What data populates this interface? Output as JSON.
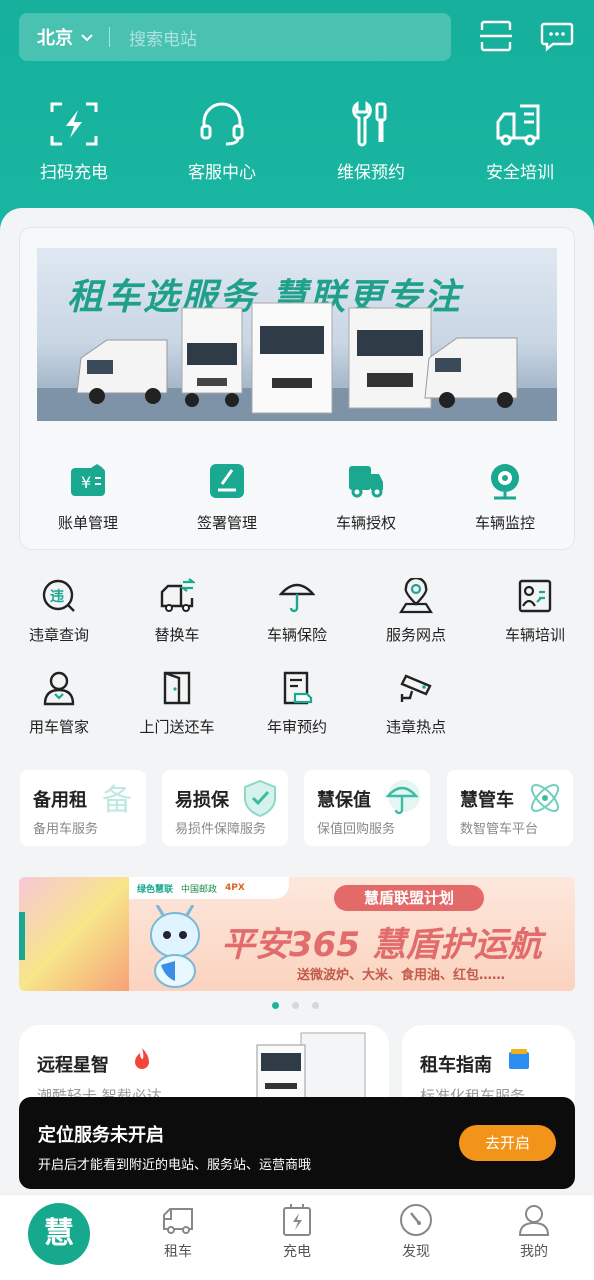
{
  "header": {
    "city": "北京",
    "search_placeholder": "搜索电站"
  },
  "quick_actions": [
    {
      "label": "扫码充电",
      "icon": "scan-charge-icon"
    },
    {
      "label": "客服中心",
      "icon": "headset-icon"
    },
    {
      "label": "维保预约",
      "icon": "tools-icon"
    },
    {
      "label": "安全培训",
      "icon": "truck-training-icon"
    }
  ],
  "banner": {
    "title": "租车选服务  慧联更专注"
  },
  "services": [
    {
      "label": "账单管理",
      "icon": "wallet-icon"
    },
    {
      "label": "签署管理",
      "icon": "sign-icon"
    },
    {
      "label": "车辆授权",
      "icon": "truck-auth-icon"
    },
    {
      "label": "车辆监控",
      "icon": "camera-icon"
    }
  ],
  "grid": [
    {
      "label": "违章查询",
      "icon": "violation-search-icon"
    },
    {
      "label": "替换车",
      "icon": "replace-car-icon"
    },
    {
      "label": "车辆保险",
      "icon": "umbrella-icon"
    },
    {
      "label": "服务网点",
      "icon": "location-icon"
    },
    {
      "label": "车辆培训",
      "icon": "training-icon"
    },
    {
      "label": "用车管家",
      "icon": "person-icon"
    },
    {
      "label": "上门送还车",
      "icon": "door-icon"
    },
    {
      "label": "年审预约",
      "icon": "inspection-icon"
    },
    {
      "label": "违章热点",
      "icon": "cctv-icon"
    }
  ],
  "mini_cards": [
    {
      "title": "备用租",
      "sub": "备用车服务"
    },
    {
      "title": "易损保",
      "sub": "易损件保障服务"
    },
    {
      "title": "慧保值",
      "sub": "保值回购服务"
    },
    {
      "title": "慧管车",
      "sub": "数智管车平台"
    }
  ],
  "promo": {
    "brand1": "绿色慧联",
    "brand2": "中国邮政",
    "brand3": "4PX",
    "plan": "慧盾联盟计划",
    "headline": "平安365 慧盾护运航",
    "sub": "送微波炉、大米、食用油、红包……"
  },
  "features": [
    {
      "title": "远程星智",
      "sub": "潮酷轻卡 智载必达"
    },
    {
      "title": "租车指南",
      "sub": "标准化租车服务"
    }
  ],
  "toast": {
    "title": "定位服务未开启",
    "sub": "开启后才能看到附近的电站、服务站、运营商哦",
    "button": "去开启"
  },
  "tabbar": {
    "home": "慧",
    "items": [
      {
        "label": "租车"
      },
      {
        "label": "充电"
      },
      {
        "label": "发现"
      },
      {
        "label": "我的"
      }
    ]
  },
  "colors": {
    "brand": "#17b19b",
    "accent": "#f3941a"
  }
}
